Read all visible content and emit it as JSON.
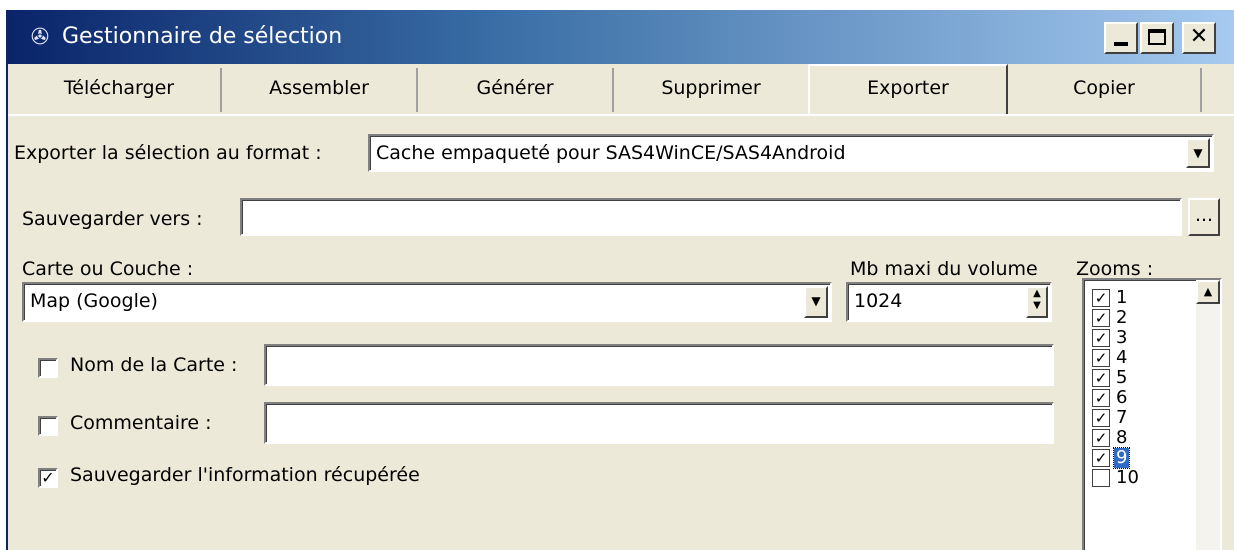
{
  "window": {
    "title": "Gestionnaire de sélection"
  },
  "tabs": [
    {
      "label": "Télécharger"
    },
    {
      "label": "Assembler"
    },
    {
      "label": "Générer"
    },
    {
      "label": "Supprimer"
    },
    {
      "label": "Exporter",
      "active": true
    },
    {
      "label": "Copier"
    }
  ],
  "export": {
    "format_label": "Exporter la sélection au format :",
    "format_value": "Cache empaqueté pour SAS4WinCE/SAS4Android",
    "save_label": "Sauvegarder vers :",
    "save_value": "",
    "browse_label": "...",
    "map_label": "Carte ou Couche :",
    "map_value": "Map (Google)",
    "volume_label": "Mb maxi du volume",
    "volume_value": "1024",
    "zooms_label": "Zooms :",
    "map_name_label": "Nom de la Carte :",
    "map_name_checked": false,
    "map_name_value": "",
    "comment_label": "Commentaire :",
    "comment_checked": false,
    "comment_value": "",
    "save_info_label": "Sauvegarder l'information récupérée",
    "save_info_checked": true
  },
  "zooms": [
    {
      "label": "1",
      "checked": true
    },
    {
      "label": "2",
      "checked": true
    },
    {
      "label": "3",
      "checked": true
    },
    {
      "label": "4",
      "checked": true
    },
    {
      "label": "5",
      "checked": true
    },
    {
      "label": "6",
      "checked": true
    },
    {
      "label": "7",
      "checked": true
    },
    {
      "label": "8",
      "checked": true
    },
    {
      "label": "9",
      "checked": true,
      "selected": true
    },
    {
      "label": "10",
      "checked": false
    }
  ],
  "colors": {
    "title_gradient_start": "#0a246a",
    "title_gradient_end": "#a6caf0",
    "face": "#ece9d8",
    "selection": "#316ac5"
  }
}
